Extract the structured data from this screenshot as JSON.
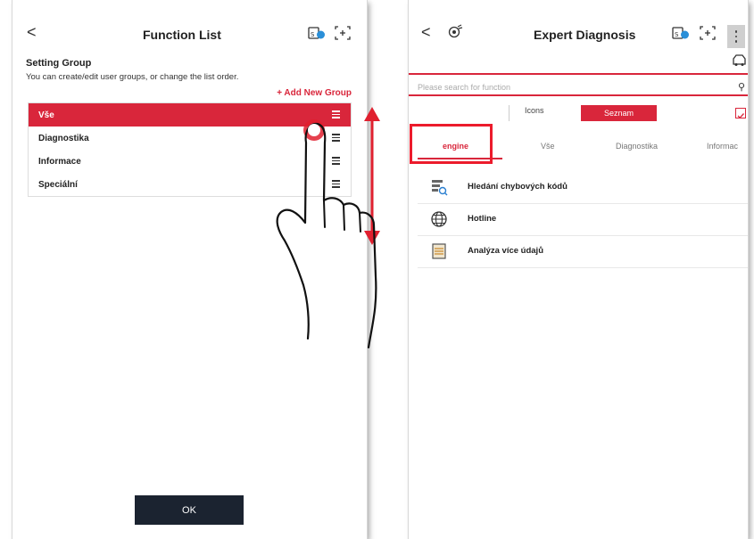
{
  "left_panel": {
    "back": "<",
    "title": "Function List",
    "setting_group_title": "Setting Group",
    "setting_group_desc": "You can create/edit user groups, or change the list order.",
    "add_group": "+ Add New Group",
    "groups": [
      {
        "label": "Vše",
        "active": true
      },
      {
        "label": "Diagnostika",
        "active": false
      },
      {
        "label": "Informace",
        "active": false
      },
      {
        "label": "Speciální",
        "active": false
      }
    ],
    "ok": "OK"
  },
  "right_panel": {
    "back": "<",
    "title": "Expert Diagnosis",
    "search_placeholder": "Please search for function",
    "view_icons": "Icons",
    "view_list": "Seznam",
    "tabs": [
      "engine",
      "Vše",
      "Diagnostika",
      "Informac"
    ],
    "functions": [
      {
        "label": "Hledání chybových kódů",
        "icon": "dtc-search-icon"
      },
      {
        "label": "Hotline",
        "icon": "globe-icon"
      },
      {
        "label": "Analýza více údajů",
        "icon": "data-analysis-icon"
      }
    ]
  },
  "colors": {
    "accent": "#d9263b",
    "highlight_box": "#ec1b2c",
    "ok_button": "#1b2330"
  }
}
